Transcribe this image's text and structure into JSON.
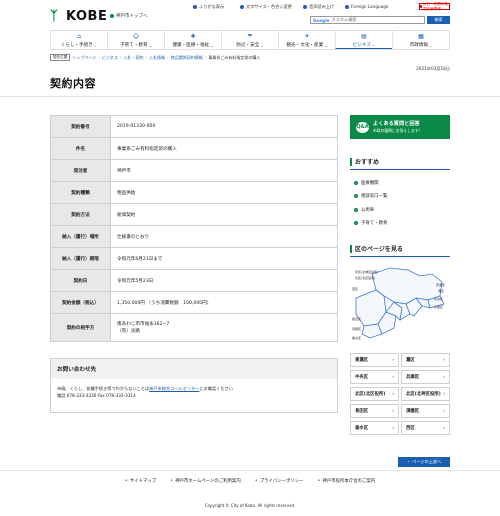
{
  "header": {
    "logo_text": "KOBE",
    "top_link": "神戸市トップへ",
    "util": [
      "ふりがな表示",
      "文字サイズ・色合い変更",
      "音声読み上げ",
      "Foreign Language"
    ],
    "emergency": "休日・夜間の救急診療情報",
    "search_placeholder": "カスタム検索",
    "search_button": "検索",
    "search_brand": "Google"
  },
  "nav": {
    "items": [
      {
        "label": "くらし・手続き",
        "icon": "house-icon"
      },
      {
        "label": "子育て・教育",
        "icon": "family-icon"
      },
      {
        "label": "健康・医療・福祉",
        "icon": "health-icon"
      },
      {
        "label": "防災・安全",
        "icon": "umbrella-icon"
      },
      {
        "label": "観光・文化・産業",
        "icon": "tourism-icon"
      },
      {
        "label": "ビジネス",
        "icon": "business-icon"
      },
      {
        "label": "市政情報",
        "icon": "city-icon"
      }
    ]
  },
  "breadcrumb": {
    "here": "現在位置",
    "items": [
      "トップページ",
      "ビジネス",
      "入札・契約",
      "入札情報",
      "物品関係契約情報"
    ],
    "current": "事業系ごみ有料指定袋の購入"
  },
  "page": {
    "date": "2021年03月18日",
    "title": "契約内容"
  },
  "contract": {
    "rows": [
      {
        "label": "契約番号",
        "value": "2019-01330-000"
      },
      {
        "label": "件名",
        "value": "事業系ごみ有料指定袋の購入"
      },
      {
        "label": "発注者",
        "value": "神戸市"
      },
      {
        "label": "契約種類",
        "value": "物品供給"
      },
      {
        "label": "契約方法",
        "value": "総価契約"
      },
      {
        "label": "納入（履行）場所",
        "value": "仕様書のとおり"
      },
      {
        "label": "納入（履行）期限",
        "value": "令和元年6月21日まで"
      },
      {
        "label": "契約日",
        "value": "令和元年5月23日"
      },
      {
        "label": "契約金額（税込）",
        "value": "1,350,000円 （うち消費税額　100,000円）"
      }
    ],
    "partner_label": "契約の相手方",
    "partner_line1": "南あわじ市市福永362−7",
    "partner_line2": "（有）淡路"
  },
  "inquiry": {
    "title": "お問い合わせ先",
    "line1_pre": "市政、くらし、各種手続き等でわからないことは",
    "line1_link": "神戸市総合コールセンター",
    "line1_post": "にお電話ください",
    "line2": "電話 078-333-3330 Fax 078-333-3314"
  },
  "sidebar": {
    "faq_title": "よくある質問と回答",
    "faq_sub": "市政の疑問にお答えします！",
    "faq_icon_text": "Q&A",
    "rec_title": "おすすめ",
    "rec_items": [
      "医療機関",
      "相談窓口一覧",
      "公用車",
      "子育て・教育"
    ],
    "map_title": "区のページを見る",
    "map_labels": [
      "北区(北神区役所)",
      "北区(北区役所)",
      "西区",
      "東灘区",
      "灘区",
      "中央区",
      "兵庫区",
      "長田区",
      "須磨区",
      "垂水区"
    ],
    "wards": [
      "東灘区",
      "灘区",
      "中央区",
      "兵庫区",
      "北区(北区役所)",
      "北区(北神区役所)",
      "長田区",
      "須磨区",
      "垂水区",
      "西区"
    ],
    "pagetop": "ページの上部へ"
  },
  "footer": {
    "links": [
      "サイトマップ",
      "神戸市ホームページのご利用案内",
      "プライバシーポリシー",
      "神戸市役所本庁舎のご案内"
    ],
    "copyright": "Copyright © City of Kobe. All rights reserved."
  },
  "colors": {
    "brand_green": "#0a8a46",
    "link_blue": "#1a5fb4",
    "emergency_red": "#cc0000"
  }
}
